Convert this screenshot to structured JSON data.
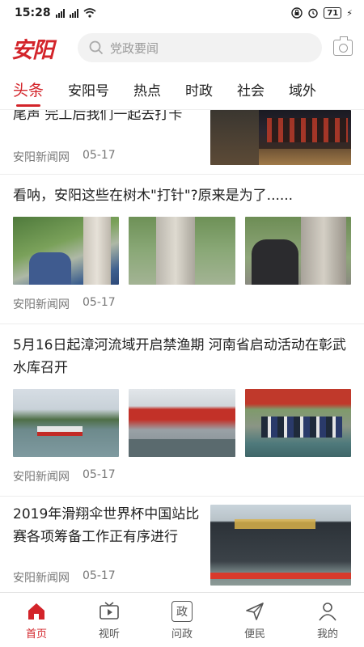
{
  "status": {
    "time": "15:28",
    "battery": "71"
  },
  "header": {
    "logo": "安阳",
    "search_placeholder": "党政要闻"
  },
  "tabs": [
    {
      "label": "头条",
      "active": true
    },
    {
      "label": "安阳号"
    },
    {
      "label": "热点"
    },
    {
      "label": "时政"
    },
    {
      "label": "社会"
    },
    {
      "label": "域外"
    }
  ],
  "feed": [
    {
      "title": "尾声 完工后我们一起去打卡",
      "source": "安阳新闻网",
      "date": "05-17"
    },
    {
      "title": "看呐，安阳这些在树木\"打针\"?原来是为了......",
      "source": "安阳新闻网",
      "date": "05-17"
    },
    {
      "title": "5月16日起漳河流域开启禁渔期 河南省启动活动在彰武水库召开",
      "source": "安阳新闻网",
      "date": "05-17"
    },
    {
      "title": "2019年滑翔伞世界杯中国站比赛各项筹备工作正有序进行",
      "source": "安阳新闻网",
      "date": "05-17"
    }
  ],
  "bottom_nav": [
    {
      "label": "首页",
      "icon": "home-icon",
      "active": true
    },
    {
      "label": "视听",
      "icon": "tv-icon"
    },
    {
      "label": "问政",
      "icon": "zheng-icon",
      "glyph": "政"
    },
    {
      "label": "便民",
      "icon": "send-icon"
    },
    {
      "label": "我的",
      "icon": "user-icon"
    }
  ],
  "colors": {
    "accent": "#d3242a"
  }
}
